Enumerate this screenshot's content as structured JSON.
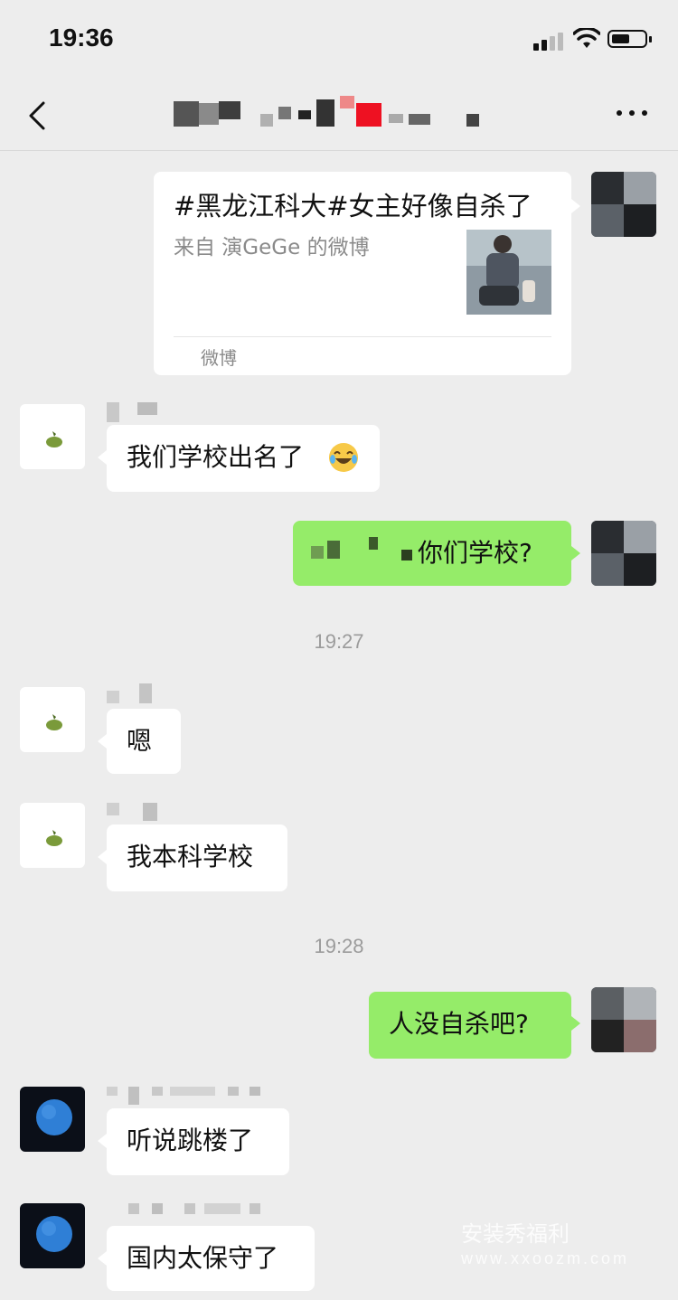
{
  "status": {
    "time": "19:36",
    "battery_fraction": 0.55
  },
  "nav": {
    "back_icon": "chevron-left-icon",
    "more_icon": "more-dots-icon"
  },
  "share_card": {
    "title": "#黑龙江科大#女主好像自杀了",
    "desc": "来自 演GeGe 的微博",
    "source": "微博"
  },
  "messages": [
    {
      "side": "in",
      "text": "我们学校出名了",
      "emoji": "laughing-crying-emoji"
    },
    {
      "side": "out",
      "text": "你们学校?"
    },
    {
      "type": "time",
      "text": "19:27"
    },
    {
      "side": "in",
      "text": "嗯"
    },
    {
      "side": "in",
      "text": "我本科学校"
    },
    {
      "type": "time",
      "text": "19:28"
    },
    {
      "side": "out",
      "text": "人没自杀吧?"
    },
    {
      "side": "in",
      "text": "听说跳楼了"
    },
    {
      "side": "in",
      "text": "国内太保守了"
    }
  ],
  "watermark": {
    "line1": "安装秀福利",
    "line2": "www.xxoozm.com"
  }
}
